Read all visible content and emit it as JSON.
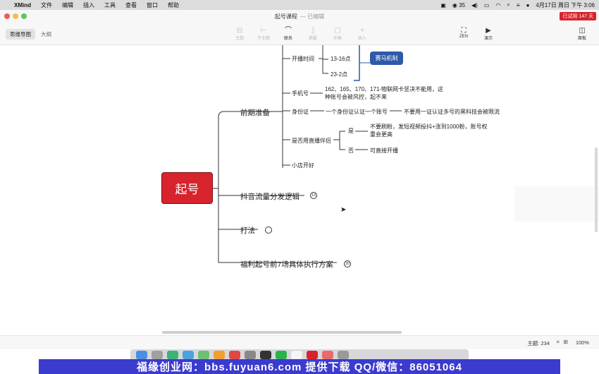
{
  "menubar": {
    "app": "XMind",
    "items": [
      "文件",
      "编辑",
      "插入",
      "工具",
      "查看",
      "窗口",
      "帮助"
    ],
    "wechat_count": "35",
    "datetime": "4月17日 周日 下午 3:06"
  },
  "window": {
    "title": "起号课程",
    "subtitle": "— 已编辑",
    "trial_badge": "已试用 147 天"
  },
  "view_tabs": [
    "思维导图",
    "大纲"
  ],
  "toolbar": {
    "topic": "主题",
    "subtopic": "子主题",
    "relation": "联系",
    "summary": "摘要",
    "boundary": "外框",
    "insert": "插入",
    "zen": "ZEN",
    "present": "演示",
    "panel": "面板"
  },
  "mindmap": {
    "central": "起号",
    "branches": [
      "前期准备",
      "抖音流量分发逻辑",
      "打法",
      "福利起号前7场具体执行方案"
    ],
    "prep": {
      "broadcast_time": "开播时间",
      "time_1": "13-16点",
      "time_2": "23-2点",
      "horse_mechanism": "赛马机制",
      "phone": "手机号",
      "phone_note_1": "162、165、170、171-物联网卡坚决不能用，这",
      "phone_note_2": "种账号会被风控，起不来",
      "id_card": "身份证",
      "id_note_1": "一个身份证认证一个账号",
      "id_note_2": "不要用一证认证多号的黑科技会被限流",
      "partner": "是否用直播伴侣",
      "yes": "是",
      "yes_note_1": "不要刷粉，发短视频投抖+涨到1000粉，账号权",
      "yes_note_2": "重会更高",
      "no": "否",
      "no_note": "可直接开播",
      "shop": "小店开好"
    },
    "collapsed_counts": [
      "13",
      "",
      "20"
    ]
  },
  "status": {
    "topics": "主题: 234",
    "zoom": "100%"
  },
  "banner": "福缘创业网：bbs.fuyuan6.com 提供下载 QQ/微信：86051064"
}
